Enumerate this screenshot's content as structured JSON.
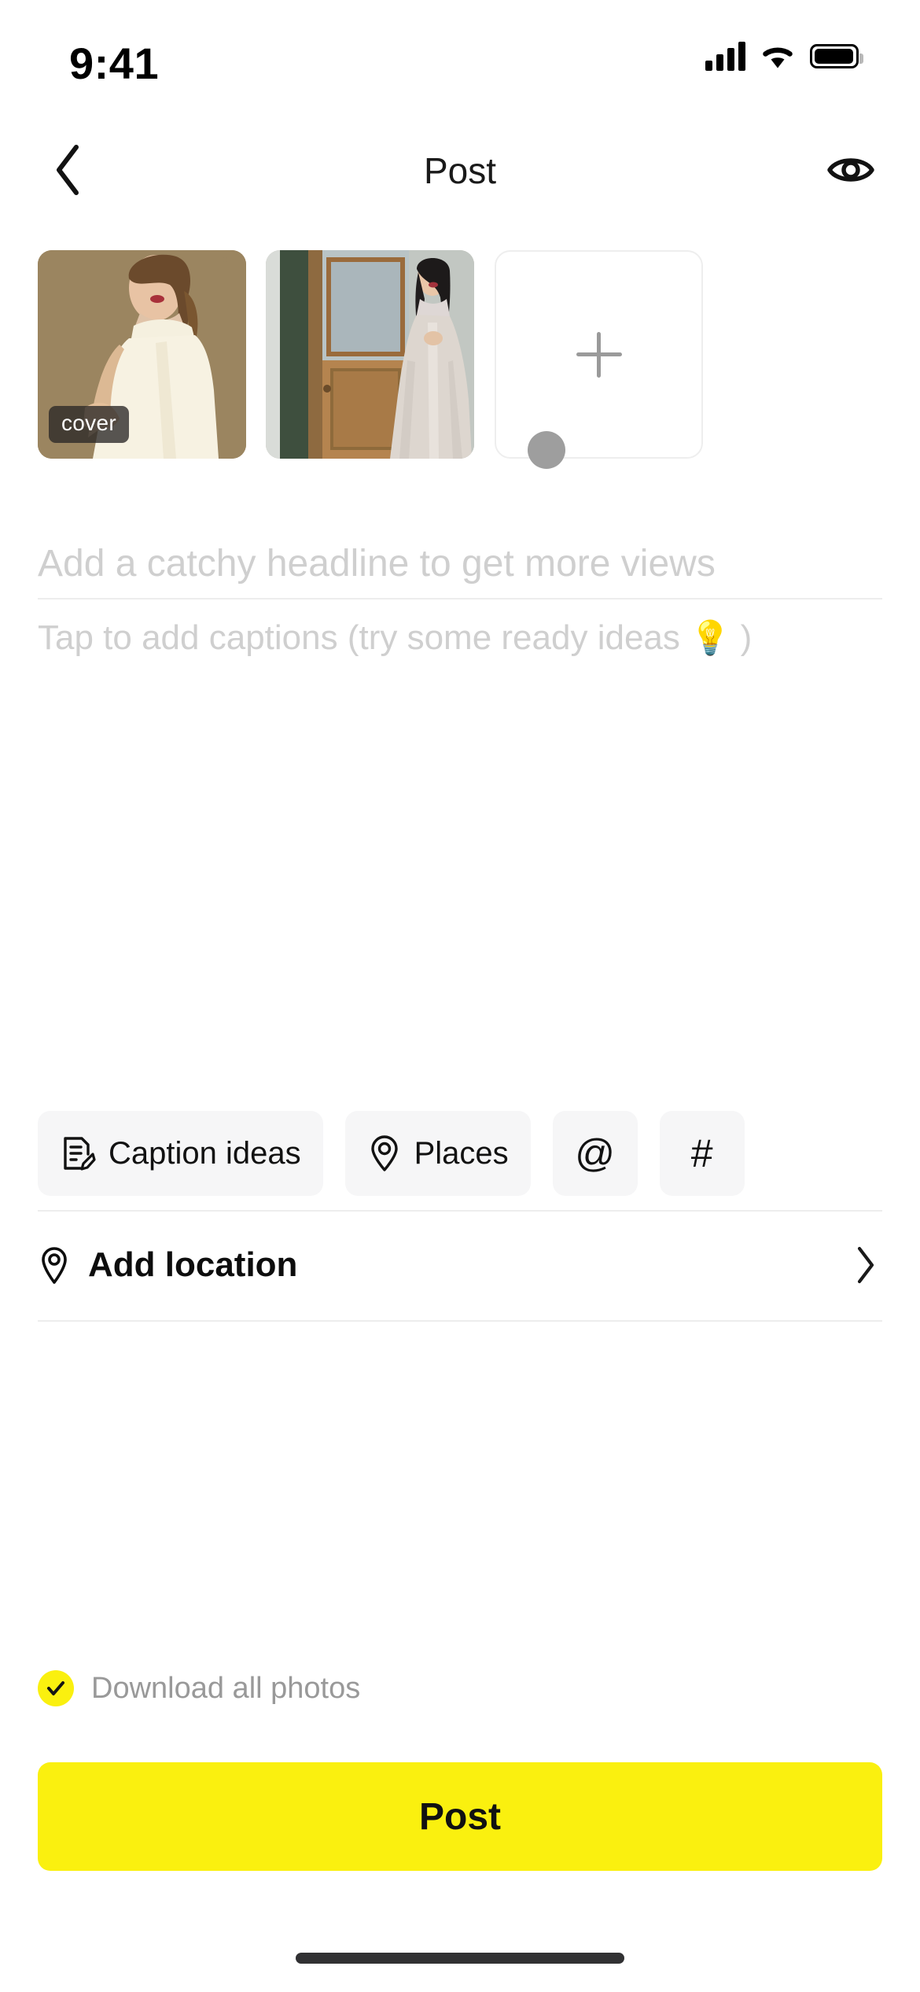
{
  "status_bar": {
    "time": "9:41",
    "signal_icon": "cellular-signal-icon",
    "wifi_icon": "wifi-icon",
    "battery_icon": "battery-full-icon"
  },
  "nav": {
    "back_icon": "chevron-left-icon",
    "title": "Post",
    "preview_icon": "eye-icon"
  },
  "media": {
    "thumbnails": [
      {
        "alt": "woman-in-white-satin-gown",
        "badge": "cover"
      },
      {
        "alt": "woman-in-white-ballgown-by-door",
        "badge": ""
      }
    ],
    "add_tile": {
      "icon": "plus-icon",
      "label": ""
    },
    "drag_handle": "drag-handle"
  },
  "headline": {
    "value": "",
    "placeholder": "Add a catchy headline to get more views"
  },
  "caption": {
    "value": "",
    "placeholder_pre": "Tap to add captions (try some ready ideas ",
    "placeholder_bulb": "💡",
    "placeholder_post": " )"
  },
  "chips": [
    {
      "name": "caption-ideas",
      "icon": "document-edit-icon",
      "label": "Caption ideas",
      "icon_only": false
    },
    {
      "name": "places",
      "icon": "location-pin-icon",
      "label": "Places",
      "icon_only": false
    },
    {
      "name": "mention",
      "icon": "at-sign-icon",
      "label": "@",
      "icon_only": true
    },
    {
      "name": "hashtag",
      "icon": "hashtag-icon",
      "label": "#",
      "icon_only": true
    }
  ],
  "location_row": {
    "icon": "location-pin-icon",
    "label": "Add location",
    "chevron": "chevron-right-icon"
  },
  "download_row": {
    "checked": true,
    "check_icon": "checkmark-icon",
    "label": "Download all photos"
  },
  "post_button": {
    "label": "Post"
  },
  "colors": {
    "accent_yellow": "#FAF00F",
    "chip_bg": "#F6F6F7",
    "placeholder_gray": "#CFCFCF",
    "divider": "#EDEDED"
  }
}
